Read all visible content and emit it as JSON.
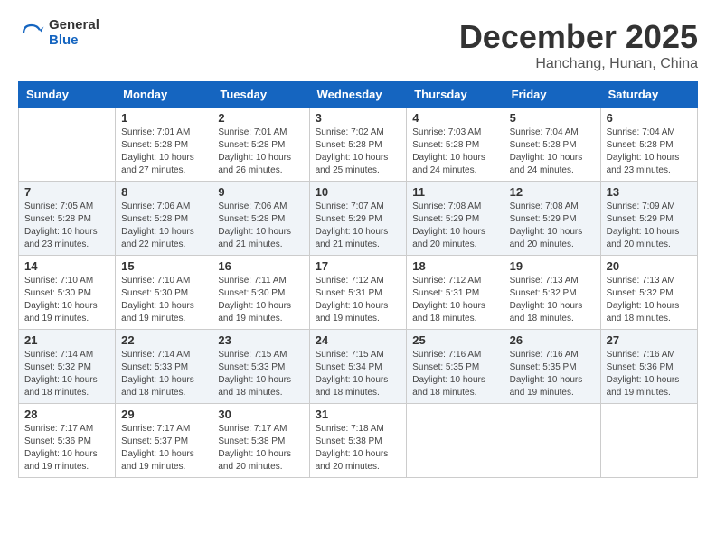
{
  "logo": {
    "general": "General",
    "blue": "Blue"
  },
  "title": "December 2025",
  "location": "Hanchang, Hunan, China",
  "weekdays": [
    "Sunday",
    "Monday",
    "Tuesday",
    "Wednesday",
    "Thursday",
    "Friday",
    "Saturday"
  ],
  "weeks": [
    [
      {
        "day": "",
        "info": ""
      },
      {
        "day": "1",
        "info": "Sunrise: 7:01 AM\nSunset: 5:28 PM\nDaylight: 10 hours\nand 27 minutes."
      },
      {
        "day": "2",
        "info": "Sunrise: 7:01 AM\nSunset: 5:28 PM\nDaylight: 10 hours\nand 26 minutes."
      },
      {
        "day": "3",
        "info": "Sunrise: 7:02 AM\nSunset: 5:28 PM\nDaylight: 10 hours\nand 25 minutes."
      },
      {
        "day": "4",
        "info": "Sunrise: 7:03 AM\nSunset: 5:28 PM\nDaylight: 10 hours\nand 24 minutes."
      },
      {
        "day": "5",
        "info": "Sunrise: 7:04 AM\nSunset: 5:28 PM\nDaylight: 10 hours\nand 24 minutes."
      },
      {
        "day": "6",
        "info": "Sunrise: 7:04 AM\nSunset: 5:28 PM\nDaylight: 10 hours\nand 23 minutes."
      }
    ],
    [
      {
        "day": "7",
        "info": "Sunrise: 7:05 AM\nSunset: 5:28 PM\nDaylight: 10 hours\nand 23 minutes."
      },
      {
        "day": "8",
        "info": "Sunrise: 7:06 AM\nSunset: 5:28 PM\nDaylight: 10 hours\nand 22 minutes."
      },
      {
        "day": "9",
        "info": "Sunrise: 7:06 AM\nSunset: 5:28 PM\nDaylight: 10 hours\nand 21 minutes."
      },
      {
        "day": "10",
        "info": "Sunrise: 7:07 AM\nSunset: 5:29 PM\nDaylight: 10 hours\nand 21 minutes."
      },
      {
        "day": "11",
        "info": "Sunrise: 7:08 AM\nSunset: 5:29 PM\nDaylight: 10 hours\nand 20 minutes."
      },
      {
        "day": "12",
        "info": "Sunrise: 7:08 AM\nSunset: 5:29 PM\nDaylight: 10 hours\nand 20 minutes."
      },
      {
        "day": "13",
        "info": "Sunrise: 7:09 AM\nSunset: 5:29 PM\nDaylight: 10 hours\nand 20 minutes."
      }
    ],
    [
      {
        "day": "14",
        "info": "Sunrise: 7:10 AM\nSunset: 5:30 PM\nDaylight: 10 hours\nand 19 minutes."
      },
      {
        "day": "15",
        "info": "Sunrise: 7:10 AM\nSunset: 5:30 PM\nDaylight: 10 hours\nand 19 minutes."
      },
      {
        "day": "16",
        "info": "Sunrise: 7:11 AM\nSunset: 5:30 PM\nDaylight: 10 hours\nand 19 minutes."
      },
      {
        "day": "17",
        "info": "Sunrise: 7:12 AM\nSunset: 5:31 PM\nDaylight: 10 hours\nand 19 minutes."
      },
      {
        "day": "18",
        "info": "Sunrise: 7:12 AM\nSunset: 5:31 PM\nDaylight: 10 hours\nand 18 minutes."
      },
      {
        "day": "19",
        "info": "Sunrise: 7:13 AM\nSunset: 5:32 PM\nDaylight: 10 hours\nand 18 minutes."
      },
      {
        "day": "20",
        "info": "Sunrise: 7:13 AM\nSunset: 5:32 PM\nDaylight: 10 hours\nand 18 minutes."
      }
    ],
    [
      {
        "day": "21",
        "info": "Sunrise: 7:14 AM\nSunset: 5:32 PM\nDaylight: 10 hours\nand 18 minutes."
      },
      {
        "day": "22",
        "info": "Sunrise: 7:14 AM\nSunset: 5:33 PM\nDaylight: 10 hours\nand 18 minutes."
      },
      {
        "day": "23",
        "info": "Sunrise: 7:15 AM\nSunset: 5:33 PM\nDaylight: 10 hours\nand 18 minutes."
      },
      {
        "day": "24",
        "info": "Sunrise: 7:15 AM\nSunset: 5:34 PM\nDaylight: 10 hours\nand 18 minutes."
      },
      {
        "day": "25",
        "info": "Sunrise: 7:16 AM\nSunset: 5:35 PM\nDaylight: 10 hours\nand 18 minutes."
      },
      {
        "day": "26",
        "info": "Sunrise: 7:16 AM\nSunset: 5:35 PM\nDaylight: 10 hours\nand 19 minutes."
      },
      {
        "day": "27",
        "info": "Sunrise: 7:16 AM\nSunset: 5:36 PM\nDaylight: 10 hours\nand 19 minutes."
      }
    ],
    [
      {
        "day": "28",
        "info": "Sunrise: 7:17 AM\nSunset: 5:36 PM\nDaylight: 10 hours\nand 19 minutes."
      },
      {
        "day": "29",
        "info": "Sunrise: 7:17 AM\nSunset: 5:37 PM\nDaylight: 10 hours\nand 19 minutes."
      },
      {
        "day": "30",
        "info": "Sunrise: 7:17 AM\nSunset: 5:38 PM\nDaylight: 10 hours\nand 20 minutes."
      },
      {
        "day": "31",
        "info": "Sunrise: 7:18 AM\nSunset: 5:38 PM\nDaylight: 10 hours\nand 20 minutes."
      },
      {
        "day": "",
        "info": ""
      },
      {
        "day": "",
        "info": ""
      },
      {
        "day": "",
        "info": ""
      }
    ]
  ]
}
